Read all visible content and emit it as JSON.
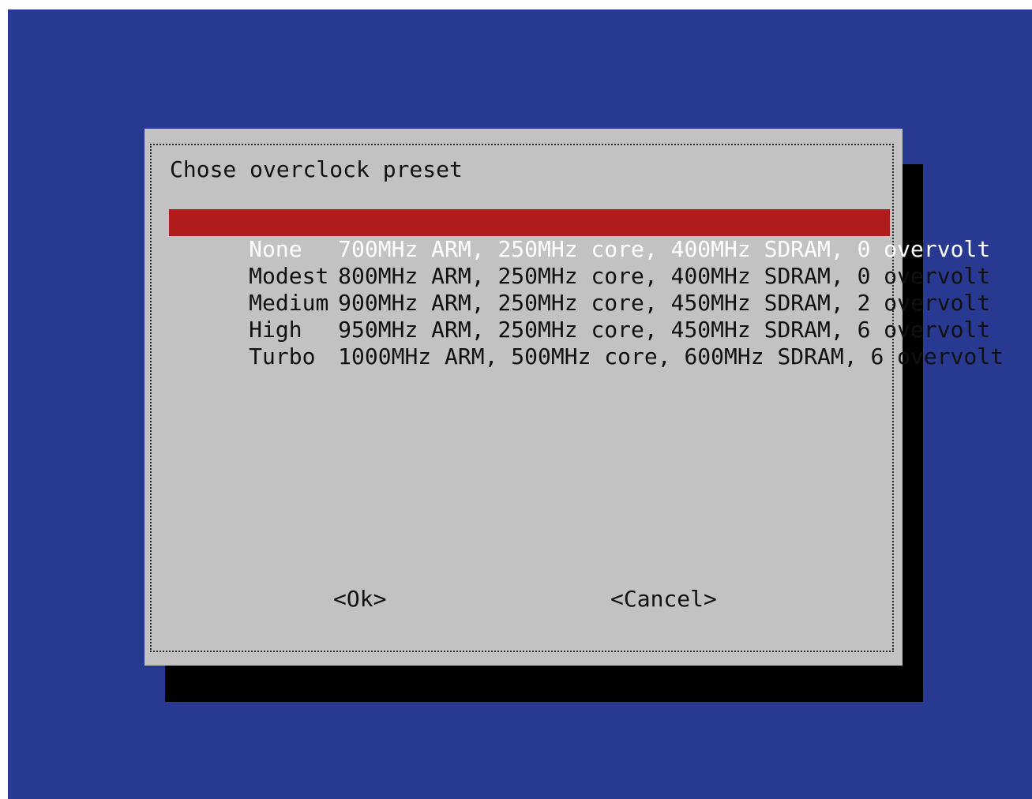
{
  "colors": {
    "screen_background": "#283991",
    "dialog_background": "#c2c2c2",
    "selection_background": "#b01c1c",
    "selection_text": "#ffffff"
  },
  "dialog": {
    "title": "Chose overclock preset",
    "items": [
      {
        "tag": "None",
        "description": "700MHz ARM, 250MHz core, 400MHz SDRAM, 0 overvolt",
        "selected": true
      },
      {
        "tag": "Modest",
        "description": "800MHz ARM, 250MHz core, 400MHz SDRAM, 0 overvolt",
        "selected": false
      },
      {
        "tag": "Medium",
        "description": "900MHz ARM, 250MHz core, 450MHz SDRAM, 2 overvolt",
        "selected": false
      },
      {
        "tag": "High",
        "description": "950MHz ARM, 250MHz core, 450MHz SDRAM, 6 overvolt",
        "selected": false
      },
      {
        "tag": "Turbo",
        "description": "1000MHz ARM, 500MHz core, 600MHz SDRAM, 6 overvolt",
        "selected": false
      }
    ],
    "ok_label": "<Ok>",
    "cancel_label": "<Cancel>"
  }
}
